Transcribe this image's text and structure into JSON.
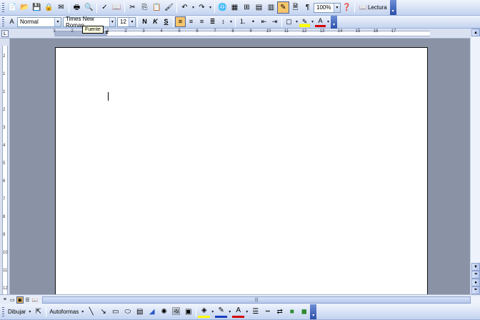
{
  "toolbar_standard": {
    "icons": [
      "new-document-icon",
      "open-icon",
      "save-icon",
      "permission-icon",
      "email-icon",
      "print-icon",
      "print-preview-icon",
      "spelling-icon",
      "research-icon",
      "cut-icon",
      "copy-icon",
      "paste-icon",
      "format-painter-icon",
      "undo-icon",
      "redo-icon",
      "hyperlink-icon",
      "tables-borders-icon",
      "insert-table-icon",
      "insert-excel-icon",
      "columns-icon",
      "drawing-icon",
      "document-map-icon",
      "show-hide-icon"
    ],
    "zoom": "100%",
    "help_icon": "help-icon",
    "read_button_label": "Lectura"
  },
  "toolbar_formatting": {
    "style": "Normal",
    "font": "Times New Roman",
    "size": "12",
    "bold": "N",
    "italic": "K",
    "underline": "S"
  },
  "tooltip": "Fuente",
  "ruler": {
    "h_marks": [
      "3",
      "2",
      "1",
      "1",
      "2",
      "3",
      "4",
      "5",
      "6",
      "7",
      "8",
      "9",
      "10",
      "11",
      "12",
      "13",
      "14",
      "15",
      "16",
      "17"
    ],
    "v_marks": [
      "2",
      "1",
      "1",
      "2",
      "3",
      "4",
      "5",
      "6",
      "7",
      "8",
      "9",
      "10",
      "11",
      "12",
      "13"
    ]
  },
  "toolbar_drawing": {
    "draw_label": "Dibujar",
    "autoshapes_label": "Autoformas"
  },
  "colors": {
    "toolbar_top": "#eef3fc",
    "toolbar_bottom": "#c3d3f0",
    "workspace": "#8a93a6",
    "active_button": "#f7c56a",
    "highlight": "#ffff00",
    "font_color": "#d40000"
  }
}
